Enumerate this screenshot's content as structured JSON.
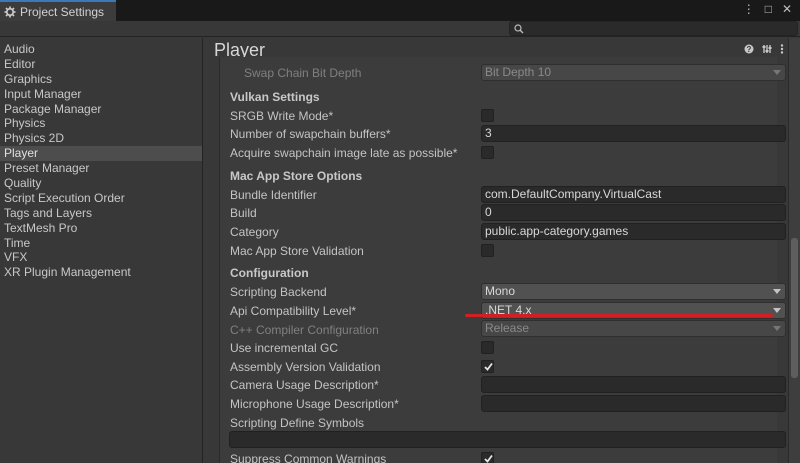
{
  "window": {
    "tab_title": "Project Settings",
    "menu_glyph": "⋮",
    "max_glyph": "□",
    "close_glyph": "✕"
  },
  "sidebar": {
    "items": [
      {
        "label": "Audio",
        "selected": false
      },
      {
        "label": "Editor",
        "selected": false
      },
      {
        "label": "Graphics",
        "selected": false
      },
      {
        "label": "Input Manager",
        "selected": false
      },
      {
        "label": "Package Manager",
        "selected": false
      },
      {
        "label": "Physics",
        "selected": false
      },
      {
        "label": "Physics 2D",
        "selected": false
      },
      {
        "label": "Player",
        "selected": true
      },
      {
        "label": "Preset Manager",
        "selected": false
      },
      {
        "label": "Quality",
        "selected": false
      },
      {
        "label": "Script Execution Order",
        "selected": false
      },
      {
        "label": "Tags and Layers",
        "selected": false
      },
      {
        "label": "TextMesh Pro",
        "selected": false
      },
      {
        "label": "Time",
        "selected": false
      },
      {
        "label": "VFX",
        "selected": false
      },
      {
        "label": "XR Plugin Management",
        "selected": false
      }
    ]
  },
  "header": {
    "title": "Player"
  },
  "settings": {
    "swap_chain": {
      "label": "Swap Chain Bit Depth",
      "value": "Bit Depth 10"
    },
    "vulkan_title": "Vulkan Settings",
    "srgb": {
      "label": "SRGB Write Mode*",
      "checked": false
    },
    "swapchain_buffers": {
      "label": "Number of swapchain buffers*",
      "value": "3"
    },
    "acquire_late": {
      "label": "Acquire swapchain image late as possible*",
      "checked": false
    },
    "mac_title": "Mac App Store Options",
    "bundle_id": {
      "label": "Bundle Identifier",
      "value": "com.DefaultCompany.VirtualCast"
    },
    "build": {
      "label": "Build",
      "value": "0"
    },
    "category": {
      "label": "Category",
      "value": "public.app-category.games"
    },
    "mac_validation": {
      "label": "Mac App Store Validation",
      "checked": false
    },
    "config_title": "Configuration",
    "scripting_backend": {
      "label": "Scripting Backend",
      "value": "Mono"
    },
    "api_level": {
      "label": "Api Compatibility Level*",
      "value": ".NET 4.x"
    },
    "cpp_config": {
      "label": "C++ Compiler Configuration",
      "value": "Release"
    },
    "incremental_gc": {
      "label": "Use incremental GC",
      "checked": false
    },
    "assembly_validation": {
      "label": "Assembly Version Validation",
      "checked": true
    },
    "camera_usage": {
      "label": "Camera Usage Description*",
      "value": ""
    },
    "mic_usage": {
      "label": "Microphone Usage Description*",
      "value": ""
    },
    "define_symbols": {
      "label": "Scripting Define Symbols",
      "value": ""
    },
    "suppress_warnings": {
      "label": "Suppress Common Warnings",
      "checked": true
    }
  },
  "colors": {
    "accent_underline": "#d21f23",
    "tab_accent": "#3a79bb"
  }
}
